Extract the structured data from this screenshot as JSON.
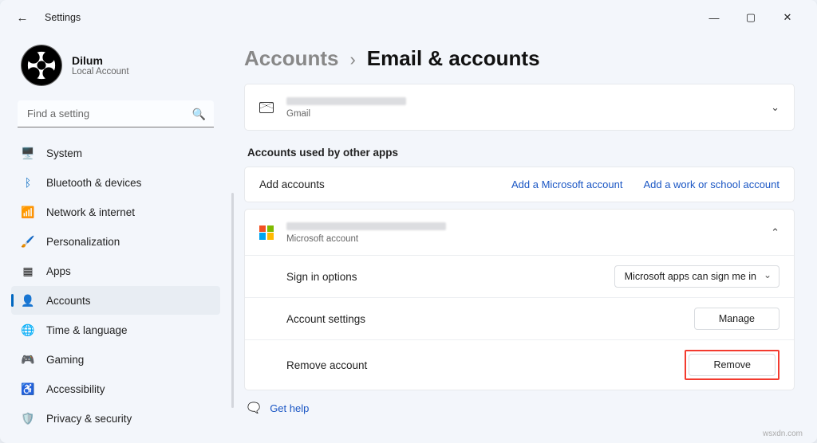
{
  "window": {
    "title": "Settings"
  },
  "profile": {
    "name": "Dilum",
    "sub": "Local Account"
  },
  "search": {
    "placeholder": "Find a setting"
  },
  "nav": {
    "system": "System",
    "bluetooth": "Bluetooth & devices",
    "network": "Network & internet",
    "personalization": "Personalization",
    "apps": "Apps",
    "accounts": "Accounts",
    "time": "Time & language",
    "gaming": "Gaming",
    "accessibility": "Accessibility",
    "privacy": "Privacy & security"
  },
  "breadcrumb": {
    "parent": "Accounts",
    "current": "Email & accounts"
  },
  "gmail": {
    "provider": "Gmail"
  },
  "section": {
    "other_apps": "Accounts used by other apps"
  },
  "add": {
    "label": "Add accounts",
    "ms_link": "Add a Microsoft account",
    "work_link": "Add a work or school account"
  },
  "ms_account": {
    "provider": "Microsoft account",
    "signin": {
      "label": "Sign in options",
      "value": "Microsoft apps can sign me in"
    },
    "settings": {
      "label": "Account settings",
      "button": "Manage"
    },
    "remove": {
      "label": "Remove account",
      "button": "Remove"
    }
  },
  "help": {
    "label": "Get help"
  },
  "watermark": "wsxdn.com"
}
